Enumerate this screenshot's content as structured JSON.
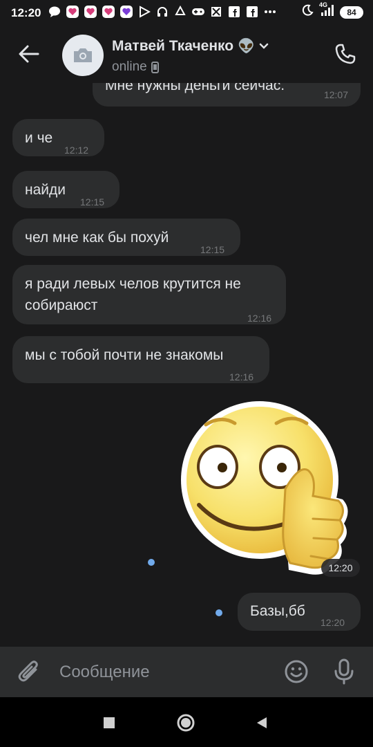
{
  "status_bar": {
    "time": "12:20",
    "battery": "84",
    "network": "4G"
  },
  "header": {
    "contact_name": "Матвей Ткаченко",
    "contact_emoji": "👽",
    "status": "online"
  },
  "messages": [
    {
      "direction": "out",
      "text": "Мне нужны деньги сейчас.",
      "time": "12:07"
    },
    {
      "direction": "in",
      "text": "и че",
      "time": "12:12"
    },
    {
      "direction": "in",
      "text": "найди",
      "time": "12:15"
    },
    {
      "direction": "in",
      "text": "чел мне как бы похуй",
      "time": "12:15"
    },
    {
      "direction": "in",
      "text": "я ради левых челов крутится не собираюст",
      "time": "12:16"
    },
    {
      "direction": "in",
      "text": "мы с тобой почти не знакомы",
      "time": "12:16"
    },
    {
      "direction": "out",
      "type": "sticker",
      "sticker": "thumbs-up-smiley",
      "time": "12:20"
    },
    {
      "direction": "out",
      "text": "Базы,бб",
      "time": "12:20"
    }
  ],
  "composer": {
    "placeholder": "Сообщение"
  },
  "colors": {
    "background": "#19191a",
    "bubble": "#2c2d2e",
    "accent": "#71aaeb",
    "text": "#e1e3e6",
    "secondary_text": "#8f9399"
  }
}
